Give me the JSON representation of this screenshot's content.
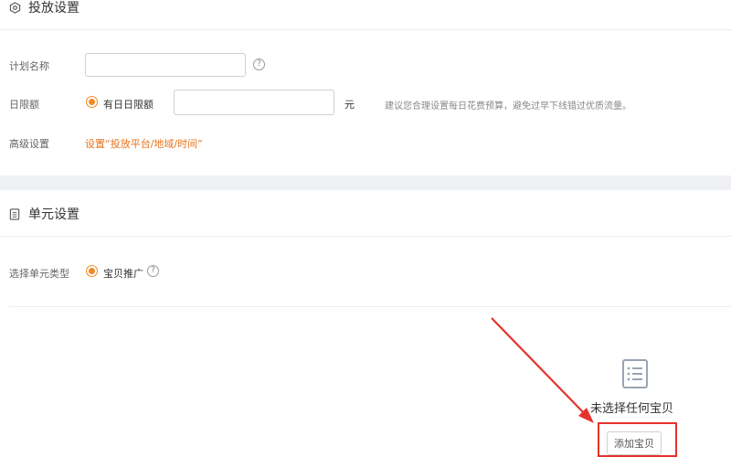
{
  "delivery_section": {
    "title": "投放设置",
    "plan_name": {
      "label": "计划名称",
      "value": "",
      "placeholder": "",
      "help": "?"
    },
    "daily_limit": {
      "label": "日限额",
      "option_label": "有日日限额",
      "value": "",
      "unit": "元",
      "tip": "建议您合理设置每日花费预算，避免过早下线错过优质流量。"
    },
    "advanced": {
      "label": "高级设置",
      "link": "设置“投放平台/地域/时间”"
    }
  },
  "unit_section": {
    "title": "单元设置",
    "unit_type": {
      "label": "选择单元类型",
      "option_label": "宝贝推广",
      "help": "?"
    }
  },
  "empty_state": {
    "message": "未选择任何宝贝",
    "add_button": "添加宝贝"
  },
  "colors": {
    "accent": "#f08a24",
    "link": "#e8731c",
    "annotation": "#e5322d",
    "band": "#eef0f3"
  },
  "icons": {
    "delivery": "hexagon-settings-icon",
    "unit": "document-list-icon",
    "empty": "document-list-icon"
  }
}
